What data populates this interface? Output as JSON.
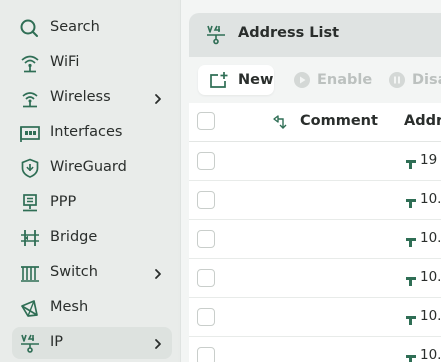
{
  "sidebar": {
    "items": [
      {
        "label": "Search",
        "icon": "search-icon",
        "has_chevron": false
      },
      {
        "label": "WiFi",
        "icon": "wifi-icon",
        "has_chevron": false
      },
      {
        "label": "Wireless",
        "icon": "wireless-icon",
        "has_chevron": true
      },
      {
        "label": "Interfaces",
        "icon": "interfaces-icon",
        "has_chevron": false
      },
      {
        "label": "WireGuard",
        "icon": "shield-icon",
        "has_chevron": false
      },
      {
        "label": "PPP",
        "icon": "ppp-icon",
        "has_chevron": false
      },
      {
        "label": "Bridge",
        "icon": "bridge-icon",
        "has_chevron": false
      },
      {
        "label": "Switch",
        "icon": "switch-icon",
        "has_chevron": true
      },
      {
        "label": "Mesh",
        "icon": "mesh-icon",
        "has_chevron": false
      },
      {
        "label": "IP",
        "icon": "ip-icon",
        "has_chevron": true,
        "active": true
      }
    ]
  },
  "header": {
    "title": "Address List",
    "icon": "ip-icon"
  },
  "toolbar": {
    "new_label": "New",
    "enable_label": "Enable",
    "disable_label": "Disa"
  },
  "table": {
    "columns": [
      "Comment",
      "Addre"
    ],
    "rows": [
      {
        "address": "19"
      },
      {
        "address": "10."
      },
      {
        "address": "10."
      },
      {
        "address": "10."
      },
      {
        "address": "10."
      },
      {
        "address": "10."
      }
    ]
  },
  "colors": {
    "accent": "#2f7a5a",
    "sidebar_bg": "#e9ecea",
    "active_bg": "#dde2df"
  }
}
